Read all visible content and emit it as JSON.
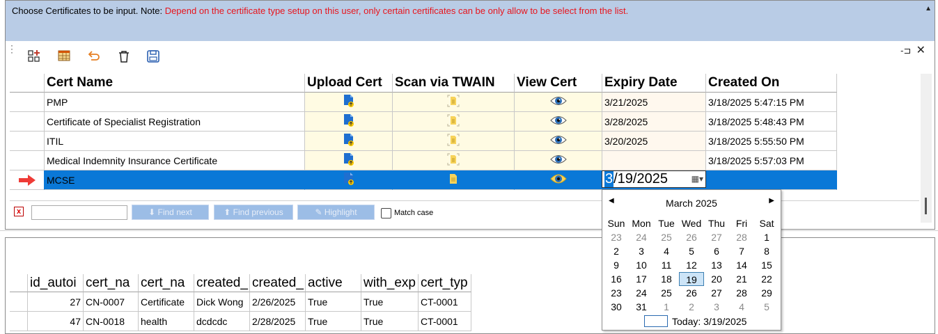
{
  "note": {
    "prefix": "Choose Certificates to be input. Note: ",
    "warning": "Depend on the certificate type setup on this user, only certain certificates can be only allow to be select from the list."
  },
  "toolbar": {
    "icons": [
      "grid-add-icon",
      "table-edit-icon",
      "undo-icon",
      "trash-icon",
      "save-icon"
    ]
  },
  "grid": {
    "columns": [
      "Cert Name",
      "Upload Cert",
      "Scan via TWAIN",
      "View Cert",
      "Expiry Date",
      "Created On"
    ],
    "rows": [
      {
        "name": "PMP",
        "expiry": "3/21/2025",
        "created": "3/18/2025 5:47:15 PM"
      },
      {
        "name": "Certificate of Specialist Registration",
        "expiry": "3/28/2025",
        "created": "3/18/2025 5:48:43 PM"
      },
      {
        "name": "ITIL",
        "expiry": "3/20/2025",
        "created": "3/18/2025 5:55:50 PM"
      },
      {
        "name": "Medical Indemnity Insurance Certificate",
        "expiry": "",
        "created": "3/18/2025 5:57:03 PM"
      },
      {
        "name": "MCSE",
        "expiry": "",
        "created": ""
      }
    ],
    "editor": {
      "first_digit": "3",
      "rest": "/19/2025"
    }
  },
  "findbar": {
    "find_next": "Find next",
    "find_previous": "Find previous",
    "highlight": "Highlight",
    "match_case": "Match case"
  },
  "calendar": {
    "month": "March 2025",
    "weekdays": [
      "Sun",
      "Mon",
      "Tue",
      "Wed",
      "Thu",
      "Fri",
      "Sat"
    ],
    "weeks": [
      [
        "23",
        "24",
        "25",
        "26",
        "27",
        "28",
        "1"
      ],
      [
        "2",
        "3",
        "4",
        "5",
        "6",
        "7",
        "8"
      ],
      [
        "9",
        "10",
        "11",
        "12",
        "13",
        "14",
        "15"
      ],
      [
        "16",
        "17",
        "18",
        "19",
        "20",
        "21",
        "22"
      ],
      [
        "23",
        "24",
        "25",
        "26",
        "27",
        "28",
        "29"
      ],
      [
        "30",
        "31",
        "1",
        "2",
        "3",
        "4",
        "5"
      ]
    ],
    "today_label": "Today: 3/19/2025"
  },
  "table2": {
    "columns": [
      "id_autoi",
      "cert_na",
      "cert_na",
      "created_",
      "created_",
      "active",
      "with_exp",
      "cert_typ"
    ],
    "rows": [
      [
        "27",
        "CN-0007",
        "Certificate",
        "Dick Wong",
        "2/26/2025",
        "True",
        "True",
        "CT-0001"
      ],
      [
        "47",
        "CN-0018",
        "health",
        "dcdcdc",
        "2/28/2025",
        "True",
        "True",
        "CT-0001"
      ]
    ]
  }
}
